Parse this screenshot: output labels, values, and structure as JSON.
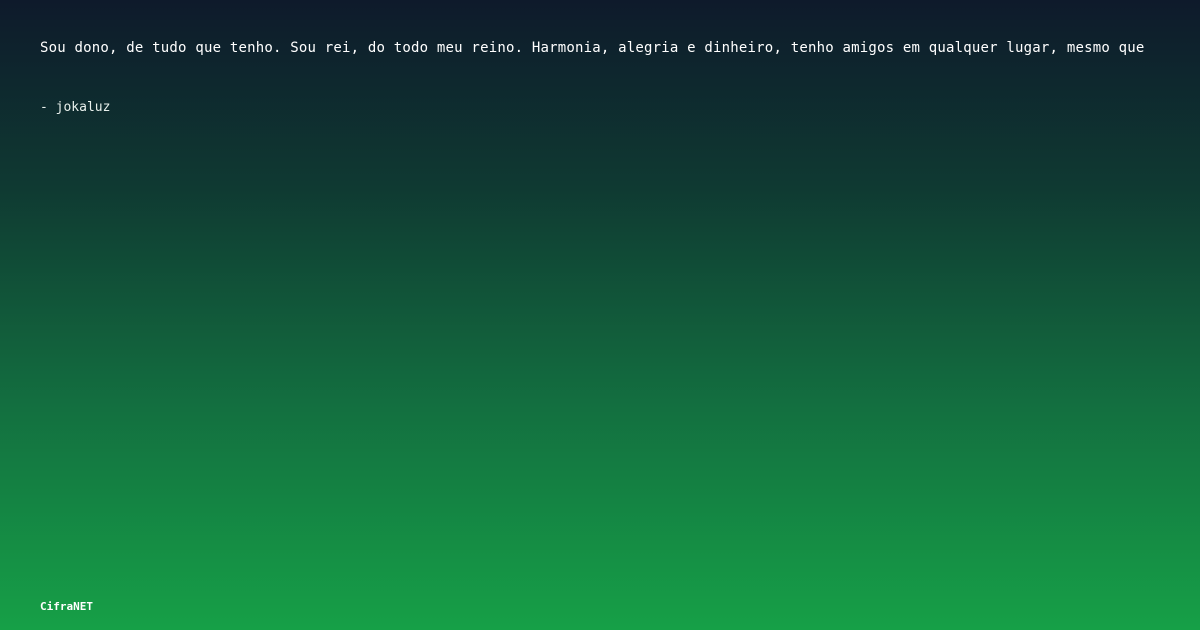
{
  "quote": {
    "text": "Sou dono, de tudo que tenho. Sou rei, do todo meu reino. Harmonia, alegria e dinheiro, tenho amigos em qualquer lugar, mesmo que"
  },
  "author": {
    "text": "- jokaluz"
  },
  "brand": {
    "text": "CifraNET"
  },
  "colors": {
    "gradient_top": "#0e1a2b",
    "gradient_bottom": "#16a047",
    "text": "#ffffff"
  }
}
